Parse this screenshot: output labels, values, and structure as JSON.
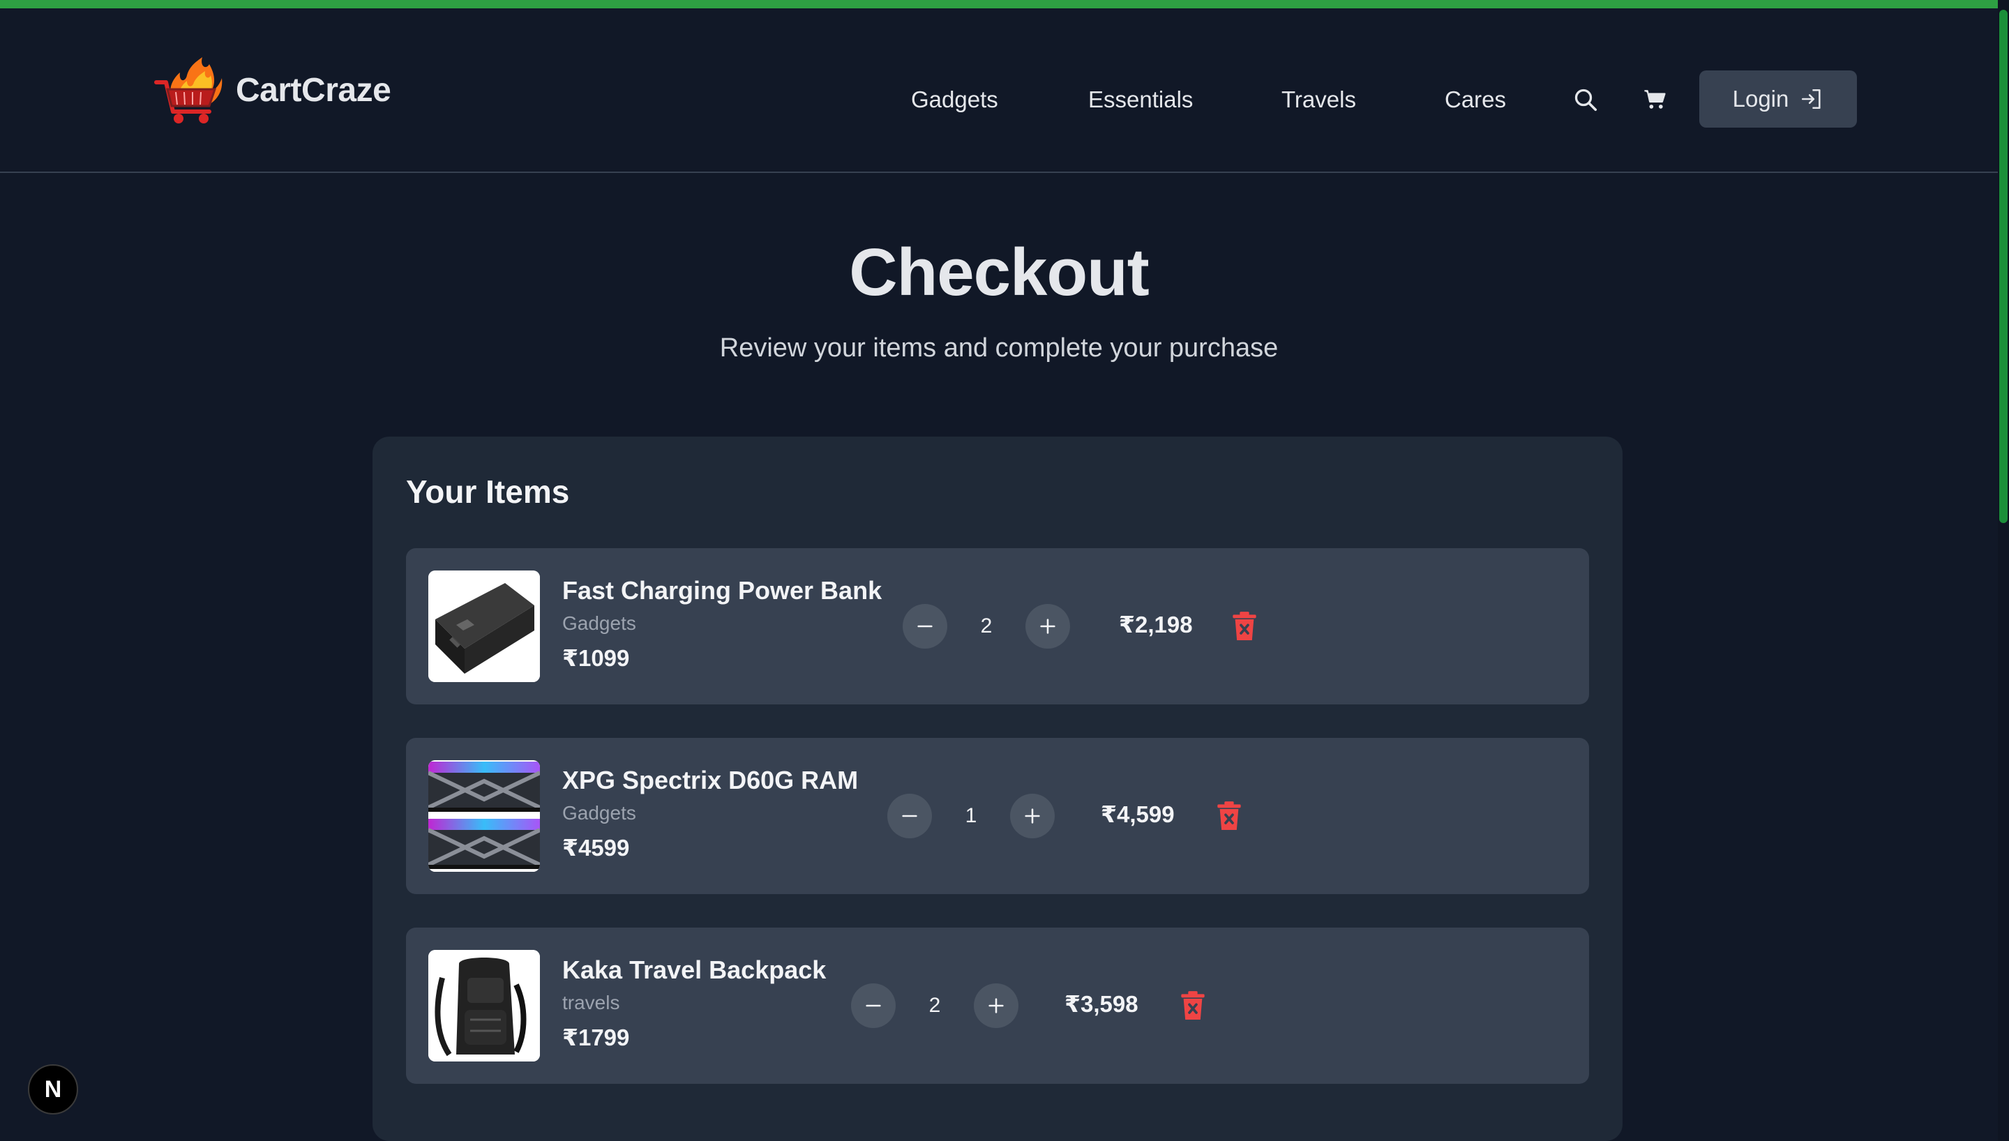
{
  "brand": {
    "name": "CartCraze",
    "logo_icon": "flaming-cart-logo"
  },
  "nav": {
    "links": [
      "Gadgets",
      "Essentials",
      "Travels",
      "Cares"
    ],
    "search_icon": "search-icon",
    "cart_icon": "cart-icon",
    "login_label": "Login",
    "login_icon": "login-icon"
  },
  "page": {
    "title": "Checkout",
    "subtitle": "Review your items and complete your purchase"
  },
  "cart": {
    "section_title": "Your Items",
    "items": [
      {
        "name": "Fast Charging Power Bank",
        "category": "Gadgets",
        "price": "₹1099",
        "quantity": "2",
        "total": "₹2,198",
        "image_icon": "power-bank-image"
      },
      {
        "name": "XPG Spectrix D60G RAM",
        "category": "Gadgets",
        "price": "₹4599",
        "quantity": "1",
        "total": "₹4,599",
        "image_icon": "ram-image"
      },
      {
        "name": "Kaka Travel Backpack",
        "category": "travels",
        "price": "₹1799",
        "quantity": "2",
        "total": "₹3,598",
        "image_icon": "backpack-image"
      }
    ]
  },
  "colors": {
    "background": "#111827",
    "card": "#1f2937",
    "item": "#374151",
    "accent_progress": "#2ea043",
    "delete": "#ef4444"
  },
  "dev_badge": {
    "label": "N"
  }
}
